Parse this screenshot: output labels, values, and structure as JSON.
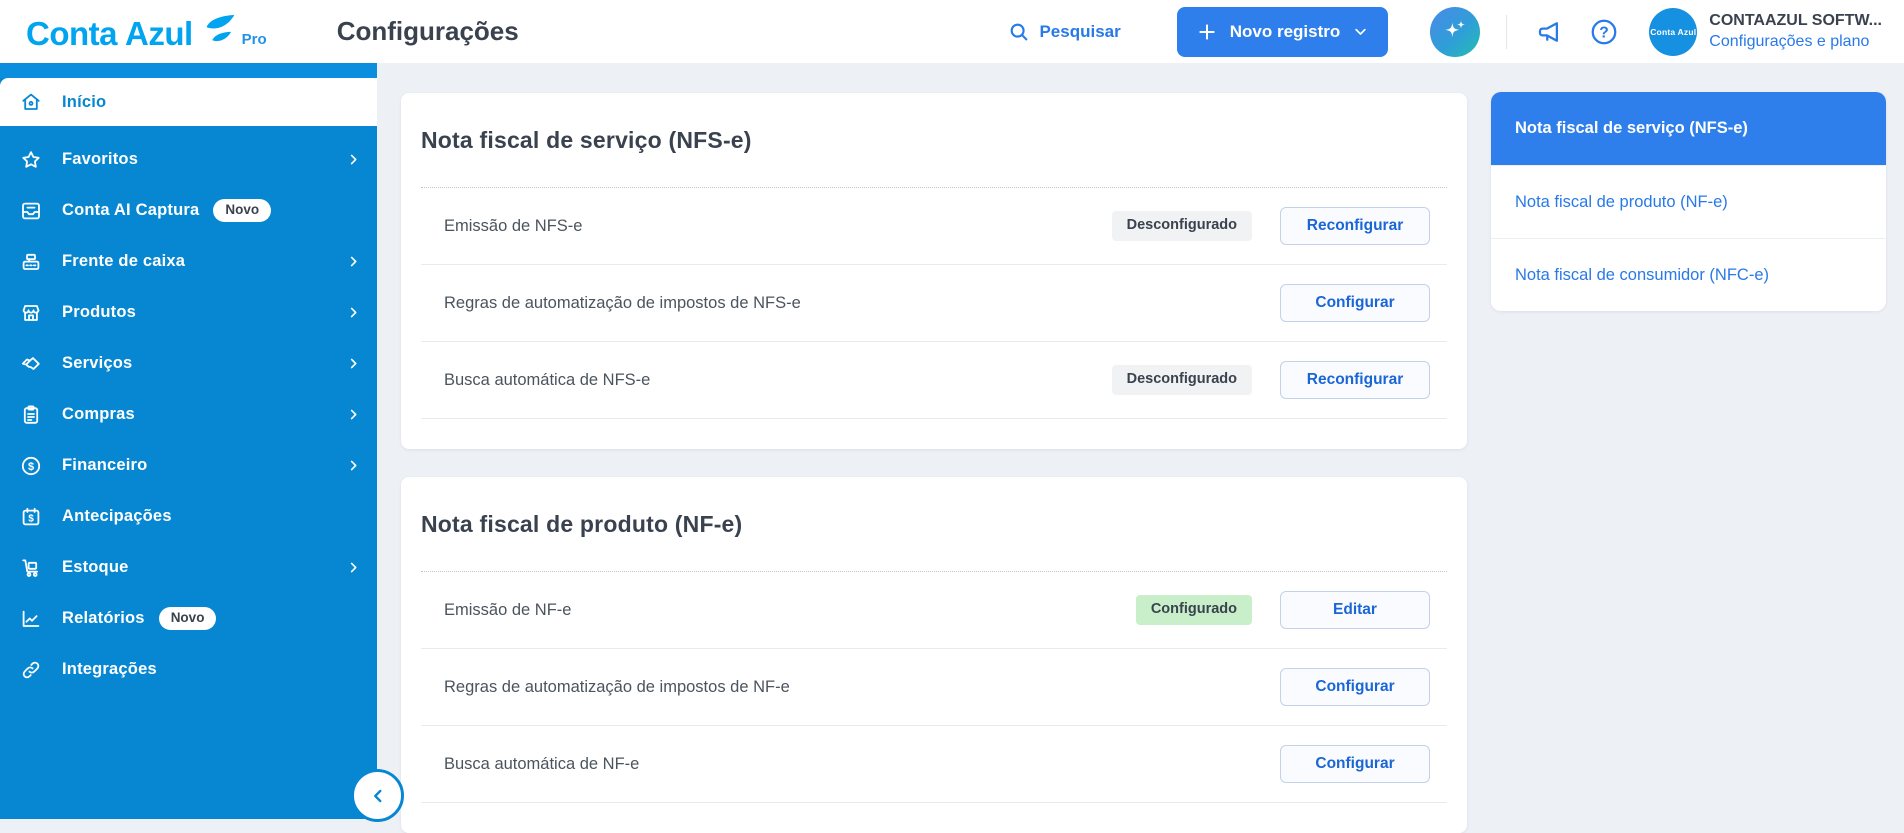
{
  "header": {
    "logo": {
      "conta": "Conta",
      "azul": "Azul",
      "pro": "Pro"
    },
    "page_title": "Configurações",
    "search_label": "Pesquisar",
    "new_record_label": "Novo registro",
    "account": {
      "avatar_text": "Conta Azul",
      "name": "CONTAAZUL SOFTW...",
      "link": "Configurações e plano"
    }
  },
  "sidebar": {
    "items": [
      {
        "label": "Início",
        "icon": "home-icon",
        "active": true
      },
      {
        "label": "Favoritos",
        "icon": "star-icon",
        "chevron": true
      },
      {
        "label": "Conta AI Captura",
        "icon": "inbox-capture-icon",
        "badge": "Novo"
      },
      {
        "label": "Frente de caixa",
        "icon": "cash-register-icon",
        "chevron": true
      },
      {
        "label": "Produtos",
        "icon": "storefront-icon",
        "chevron": true
      },
      {
        "label": "Serviços",
        "icon": "handshake-icon",
        "chevron": true
      },
      {
        "label": "Compras",
        "icon": "clipboard-icon",
        "chevron": true
      },
      {
        "label": "Financeiro",
        "icon": "dollar-circle-icon",
        "chevron": true
      },
      {
        "label": "Antecipações",
        "icon": "calendar-dollar-icon"
      },
      {
        "label": "Estoque",
        "icon": "stock-dolly-icon",
        "chevron": true
      },
      {
        "label": "Relatórios",
        "icon": "chart-line-icon",
        "badge": "Novo"
      },
      {
        "label": "Integrações",
        "icon": "link-icon"
      }
    ]
  },
  "main": {
    "cards": [
      {
        "title": "Nota fiscal de serviço (NFS-e)",
        "rows": [
          {
            "label": "Emissão de NFS-e",
            "badge": "Desconfigurado",
            "badge_type": "gray",
            "button": "Reconfigurar"
          },
          {
            "label": "Regras de automatização de impostos de NFS-e",
            "button": "Configurar"
          },
          {
            "label": "Busca automática de NFS-e",
            "badge": "Desconfigurado",
            "badge_type": "gray",
            "button": "Reconfigurar"
          }
        ]
      },
      {
        "title": "Nota fiscal de produto (NF-e)",
        "rows": [
          {
            "label": "Emissão de NF-e",
            "badge": "Configurado",
            "badge_type": "green",
            "button": "Editar"
          },
          {
            "label": "Regras de automatização de impostos de NF-e",
            "button": "Configurar"
          },
          {
            "label": "Busca automática de NF-e",
            "button": "Configurar"
          }
        ]
      }
    ]
  },
  "right_nav": {
    "items": [
      {
        "label": "Nota fiscal de serviço (NFS-e)",
        "active": true
      },
      {
        "label": "Nota fiscal de produto (NF-e)"
      },
      {
        "label": "Nota fiscal de consumidor (NFC-e)"
      }
    ]
  },
  "colors": {
    "sidebar_blue": "#0787d2",
    "accent_blue": "#2e7fec",
    "logo_blue": "#00a4ef",
    "text_dark": "#39424e",
    "badge_gray_bg": "#f1f2f3",
    "badge_green_bg": "#c9efca",
    "row_button_text": "#1b66d6",
    "page_bg": "#edf1f6"
  }
}
